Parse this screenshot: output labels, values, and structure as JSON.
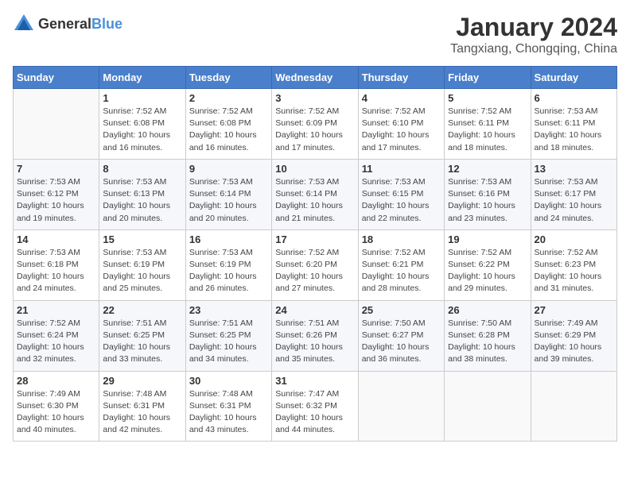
{
  "logo": {
    "text_general": "General",
    "text_blue": "Blue"
  },
  "header": {
    "title": "January 2024",
    "subtitle": "Tangxiang, Chongqing, China"
  },
  "weekdays": [
    "Sunday",
    "Monday",
    "Tuesday",
    "Wednesday",
    "Thursday",
    "Friday",
    "Saturday"
  ],
  "weeks": [
    [
      {
        "day": "",
        "info": ""
      },
      {
        "day": "1",
        "info": "Sunrise: 7:52 AM\nSunset: 6:08 PM\nDaylight: 10 hours\nand 16 minutes."
      },
      {
        "day": "2",
        "info": "Sunrise: 7:52 AM\nSunset: 6:08 PM\nDaylight: 10 hours\nand 16 minutes."
      },
      {
        "day": "3",
        "info": "Sunrise: 7:52 AM\nSunset: 6:09 PM\nDaylight: 10 hours\nand 17 minutes."
      },
      {
        "day": "4",
        "info": "Sunrise: 7:52 AM\nSunset: 6:10 PM\nDaylight: 10 hours\nand 17 minutes."
      },
      {
        "day": "5",
        "info": "Sunrise: 7:52 AM\nSunset: 6:11 PM\nDaylight: 10 hours\nand 18 minutes."
      },
      {
        "day": "6",
        "info": "Sunrise: 7:53 AM\nSunset: 6:11 PM\nDaylight: 10 hours\nand 18 minutes."
      }
    ],
    [
      {
        "day": "7",
        "info": "Sunrise: 7:53 AM\nSunset: 6:12 PM\nDaylight: 10 hours\nand 19 minutes."
      },
      {
        "day": "8",
        "info": "Sunrise: 7:53 AM\nSunset: 6:13 PM\nDaylight: 10 hours\nand 20 minutes."
      },
      {
        "day": "9",
        "info": "Sunrise: 7:53 AM\nSunset: 6:14 PM\nDaylight: 10 hours\nand 20 minutes."
      },
      {
        "day": "10",
        "info": "Sunrise: 7:53 AM\nSunset: 6:14 PM\nDaylight: 10 hours\nand 21 minutes."
      },
      {
        "day": "11",
        "info": "Sunrise: 7:53 AM\nSunset: 6:15 PM\nDaylight: 10 hours\nand 22 minutes."
      },
      {
        "day": "12",
        "info": "Sunrise: 7:53 AM\nSunset: 6:16 PM\nDaylight: 10 hours\nand 23 minutes."
      },
      {
        "day": "13",
        "info": "Sunrise: 7:53 AM\nSunset: 6:17 PM\nDaylight: 10 hours\nand 24 minutes."
      }
    ],
    [
      {
        "day": "14",
        "info": "Sunrise: 7:53 AM\nSunset: 6:18 PM\nDaylight: 10 hours\nand 24 minutes."
      },
      {
        "day": "15",
        "info": "Sunrise: 7:53 AM\nSunset: 6:19 PM\nDaylight: 10 hours\nand 25 minutes."
      },
      {
        "day": "16",
        "info": "Sunrise: 7:53 AM\nSunset: 6:19 PM\nDaylight: 10 hours\nand 26 minutes."
      },
      {
        "day": "17",
        "info": "Sunrise: 7:52 AM\nSunset: 6:20 PM\nDaylight: 10 hours\nand 27 minutes."
      },
      {
        "day": "18",
        "info": "Sunrise: 7:52 AM\nSunset: 6:21 PM\nDaylight: 10 hours\nand 28 minutes."
      },
      {
        "day": "19",
        "info": "Sunrise: 7:52 AM\nSunset: 6:22 PM\nDaylight: 10 hours\nand 29 minutes."
      },
      {
        "day": "20",
        "info": "Sunrise: 7:52 AM\nSunset: 6:23 PM\nDaylight: 10 hours\nand 31 minutes."
      }
    ],
    [
      {
        "day": "21",
        "info": "Sunrise: 7:52 AM\nSunset: 6:24 PM\nDaylight: 10 hours\nand 32 minutes."
      },
      {
        "day": "22",
        "info": "Sunrise: 7:51 AM\nSunset: 6:25 PM\nDaylight: 10 hours\nand 33 minutes."
      },
      {
        "day": "23",
        "info": "Sunrise: 7:51 AM\nSunset: 6:25 PM\nDaylight: 10 hours\nand 34 minutes."
      },
      {
        "day": "24",
        "info": "Sunrise: 7:51 AM\nSunset: 6:26 PM\nDaylight: 10 hours\nand 35 minutes."
      },
      {
        "day": "25",
        "info": "Sunrise: 7:50 AM\nSunset: 6:27 PM\nDaylight: 10 hours\nand 36 minutes."
      },
      {
        "day": "26",
        "info": "Sunrise: 7:50 AM\nSunset: 6:28 PM\nDaylight: 10 hours\nand 38 minutes."
      },
      {
        "day": "27",
        "info": "Sunrise: 7:49 AM\nSunset: 6:29 PM\nDaylight: 10 hours\nand 39 minutes."
      }
    ],
    [
      {
        "day": "28",
        "info": "Sunrise: 7:49 AM\nSunset: 6:30 PM\nDaylight: 10 hours\nand 40 minutes."
      },
      {
        "day": "29",
        "info": "Sunrise: 7:48 AM\nSunset: 6:31 PM\nDaylight: 10 hours\nand 42 minutes."
      },
      {
        "day": "30",
        "info": "Sunrise: 7:48 AM\nSunset: 6:31 PM\nDaylight: 10 hours\nand 43 minutes."
      },
      {
        "day": "31",
        "info": "Sunrise: 7:47 AM\nSunset: 6:32 PM\nDaylight: 10 hours\nand 44 minutes."
      },
      {
        "day": "",
        "info": ""
      },
      {
        "day": "",
        "info": ""
      },
      {
        "day": "",
        "info": ""
      }
    ]
  ]
}
